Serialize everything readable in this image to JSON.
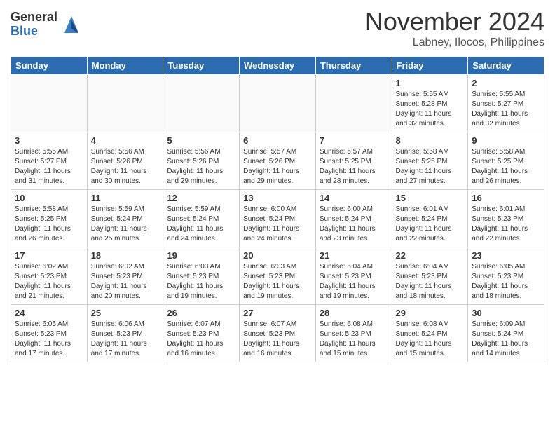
{
  "header": {
    "logo_general": "General",
    "logo_blue": "Blue",
    "month_title": "November 2024",
    "location": "Labney, Ilocos, Philippines"
  },
  "days_of_week": [
    "Sunday",
    "Monday",
    "Tuesday",
    "Wednesday",
    "Thursday",
    "Friday",
    "Saturday"
  ],
  "weeks": [
    [
      {
        "day": "",
        "info": ""
      },
      {
        "day": "",
        "info": ""
      },
      {
        "day": "",
        "info": ""
      },
      {
        "day": "",
        "info": ""
      },
      {
        "day": "",
        "info": ""
      },
      {
        "day": "1",
        "info": "Sunrise: 5:55 AM\nSunset: 5:28 PM\nDaylight: 11 hours and 32 minutes."
      },
      {
        "day": "2",
        "info": "Sunrise: 5:55 AM\nSunset: 5:27 PM\nDaylight: 11 hours and 32 minutes."
      }
    ],
    [
      {
        "day": "3",
        "info": "Sunrise: 5:55 AM\nSunset: 5:27 PM\nDaylight: 11 hours and 31 minutes."
      },
      {
        "day": "4",
        "info": "Sunrise: 5:56 AM\nSunset: 5:26 PM\nDaylight: 11 hours and 30 minutes."
      },
      {
        "day": "5",
        "info": "Sunrise: 5:56 AM\nSunset: 5:26 PM\nDaylight: 11 hours and 29 minutes."
      },
      {
        "day": "6",
        "info": "Sunrise: 5:57 AM\nSunset: 5:26 PM\nDaylight: 11 hours and 29 minutes."
      },
      {
        "day": "7",
        "info": "Sunrise: 5:57 AM\nSunset: 5:25 PM\nDaylight: 11 hours and 28 minutes."
      },
      {
        "day": "8",
        "info": "Sunrise: 5:58 AM\nSunset: 5:25 PM\nDaylight: 11 hours and 27 minutes."
      },
      {
        "day": "9",
        "info": "Sunrise: 5:58 AM\nSunset: 5:25 PM\nDaylight: 11 hours and 26 minutes."
      }
    ],
    [
      {
        "day": "10",
        "info": "Sunrise: 5:58 AM\nSunset: 5:25 PM\nDaylight: 11 hours and 26 minutes."
      },
      {
        "day": "11",
        "info": "Sunrise: 5:59 AM\nSunset: 5:24 PM\nDaylight: 11 hours and 25 minutes."
      },
      {
        "day": "12",
        "info": "Sunrise: 5:59 AM\nSunset: 5:24 PM\nDaylight: 11 hours and 24 minutes."
      },
      {
        "day": "13",
        "info": "Sunrise: 6:00 AM\nSunset: 5:24 PM\nDaylight: 11 hours and 24 minutes."
      },
      {
        "day": "14",
        "info": "Sunrise: 6:00 AM\nSunset: 5:24 PM\nDaylight: 11 hours and 23 minutes."
      },
      {
        "day": "15",
        "info": "Sunrise: 6:01 AM\nSunset: 5:24 PM\nDaylight: 11 hours and 22 minutes."
      },
      {
        "day": "16",
        "info": "Sunrise: 6:01 AM\nSunset: 5:23 PM\nDaylight: 11 hours and 22 minutes."
      }
    ],
    [
      {
        "day": "17",
        "info": "Sunrise: 6:02 AM\nSunset: 5:23 PM\nDaylight: 11 hours and 21 minutes."
      },
      {
        "day": "18",
        "info": "Sunrise: 6:02 AM\nSunset: 5:23 PM\nDaylight: 11 hours and 20 minutes."
      },
      {
        "day": "19",
        "info": "Sunrise: 6:03 AM\nSunset: 5:23 PM\nDaylight: 11 hours and 19 minutes."
      },
      {
        "day": "20",
        "info": "Sunrise: 6:03 AM\nSunset: 5:23 PM\nDaylight: 11 hours and 19 minutes."
      },
      {
        "day": "21",
        "info": "Sunrise: 6:04 AM\nSunset: 5:23 PM\nDaylight: 11 hours and 19 minutes."
      },
      {
        "day": "22",
        "info": "Sunrise: 6:04 AM\nSunset: 5:23 PM\nDaylight: 11 hours and 18 minutes."
      },
      {
        "day": "23",
        "info": "Sunrise: 6:05 AM\nSunset: 5:23 PM\nDaylight: 11 hours and 18 minutes."
      }
    ],
    [
      {
        "day": "24",
        "info": "Sunrise: 6:05 AM\nSunset: 5:23 PM\nDaylight: 11 hours and 17 minutes."
      },
      {
        "day": "25",
        "info": "Sunrise: 6:06 AM\nSunset: 5:23 PM\nDaylight: 11 hours and 17 minutes."
      },
      {
        "day": "26",
        "info": "Sunrise: 6:07 AM\nSunset: 5:23 PM\nDaylight: 11 hours and 16 minutes."
      },
      {
        "day": "27",
        "info": "Sunrise: 6:07 AM\nSunset: 5:23 PM\nDaylight: 11 hours and 16 minutes."
      },
      {
        "day": "28",
        "info": "Sunrise: 6:08 AM\nSunset: 5:23 PM\nDaylight: 11 hours and 15 minutes."
      },
      {
        "day": "29",
        "info": "Sunrise: 6:08 AM\nSunset: 5:24 PM\nDaylight: 11 hours and 15 minutes."
      },
      {
        "day": "30",
        "info": "Sunrise: 6:09 AM\nSunset: 5:24 PM\nDaylight: 11 hours and 14 minutes."
      }
    ]
  ]
}
